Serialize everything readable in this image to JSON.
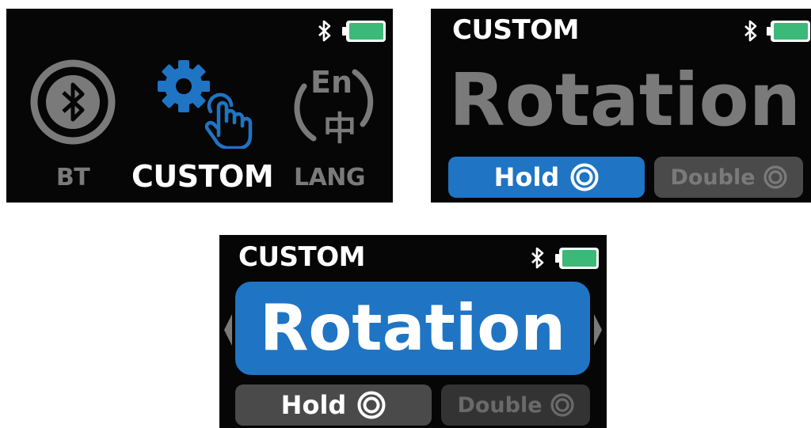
{
  "colors": {
    "screen_bg": "#060606",
    "accent_blue": "#1f74c4",
    "gray_text": "#7a7a7a",
    "gray_pill": "#4a4a4a",
    "battery_green": "#3cb878",
    "white": "#ffffff"
  },
  "menu_screen": {
    "items": [
      {
        "label": "BT",
        "icon": "bluetooth-circle-icon",
        "selected": false
      },
      {
        "label": "CUSTOM",
        "icon": "gear-tap-icon",
        "selected": true
      },
      {
        "label": "LANG",
        "icon": "language-en-zh-icon"
      }
    ],
    "lang_icon_text": {
      "top": "En",
      "bottom": "中"
    },
    "status": {
      "bluetooth": "bluetooth-icon",
      "battery": "battery-full-icon"
    }
  },
  "custom_screen_1": {
    "title": "CUSTOM",
    "function_name": "Rotation",
    "options": [
      {
        "label": "Hold",
        "active": true
      },
      {
        "label": "Double",
        "active": false
      }
    ]
  },
  "custom_screen_2": {
    "title": "CUSTOM",
    "function_name": "Rotation",
    "options": [
      {
        "label": "Hold",
        "active": false
      },
      {
        "label": "Double",
        "active": false
      }
    ],
    "nav": {
      "left": "arrow-left-icon",
      "right": "arrow-right-icon"
    }
  }
}
